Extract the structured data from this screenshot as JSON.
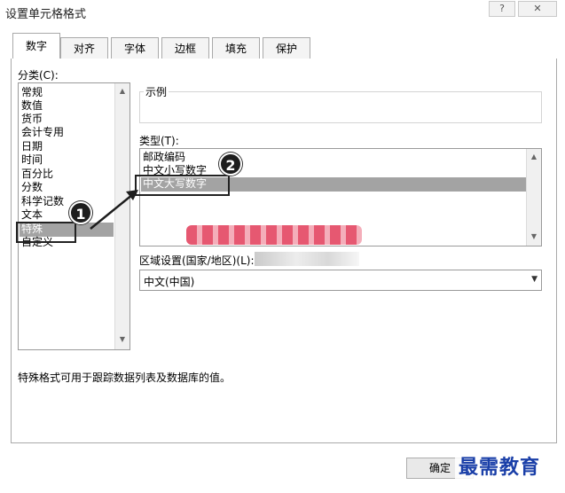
{
  "window": {
    "title": "设置单元格格式",
    "help_glyph": "?",
    "close_glyph": "✕"
  },
  "tabs": [
    {
      "label": "数字",
      "active": true
    },
    {
      "label": "对齐",
      "active": false
    },
    {
      "label": "字体",
      "active": false
    },
    {
      "label": "边框",
      "active": false
    },
    {
      "label": "填充",
      "active": false
    },
    {
      "label": "保护",
      "active": false
    }
  ],
  "category": {
    "label": "分类(C):",
    "items": [
      "常规",
      "数值",
      "货币",
      "会计专用",
      "日期",
      "时间",
      "百分比",
      "分数",
      "科学记数",
      "文本",
      "特殊",
      "自定义"
    ],
    "selected": "特殊"
  },
  "sample": {
    "label": "示例"
  },
  "type": {
    "label": "类型(T):",
    "items": [
      "邮政编码",
      "中文小写数字",
      "中文大写数字"
    ],
    "selected": "中文大写数字"
  },
  "locale": {
    "label": "区域设置(国家/地区)(L):",
    "value": "中文(中国)"
  },
  "description": "特殊格式可用于跟踪数据列表及数据库的值。",
  "callouts": [
    "1",
    "2"
  ],
  "buttons": {
    "ok": "确定"
  },
  "watermark": "最需教育",
  "colors": {
    "selection": "#a3a3a3",
    "callout": "#1d1d1d",
    "watermark": "#1a3fa8",
    "blur": "#e23a58"
  }
}
